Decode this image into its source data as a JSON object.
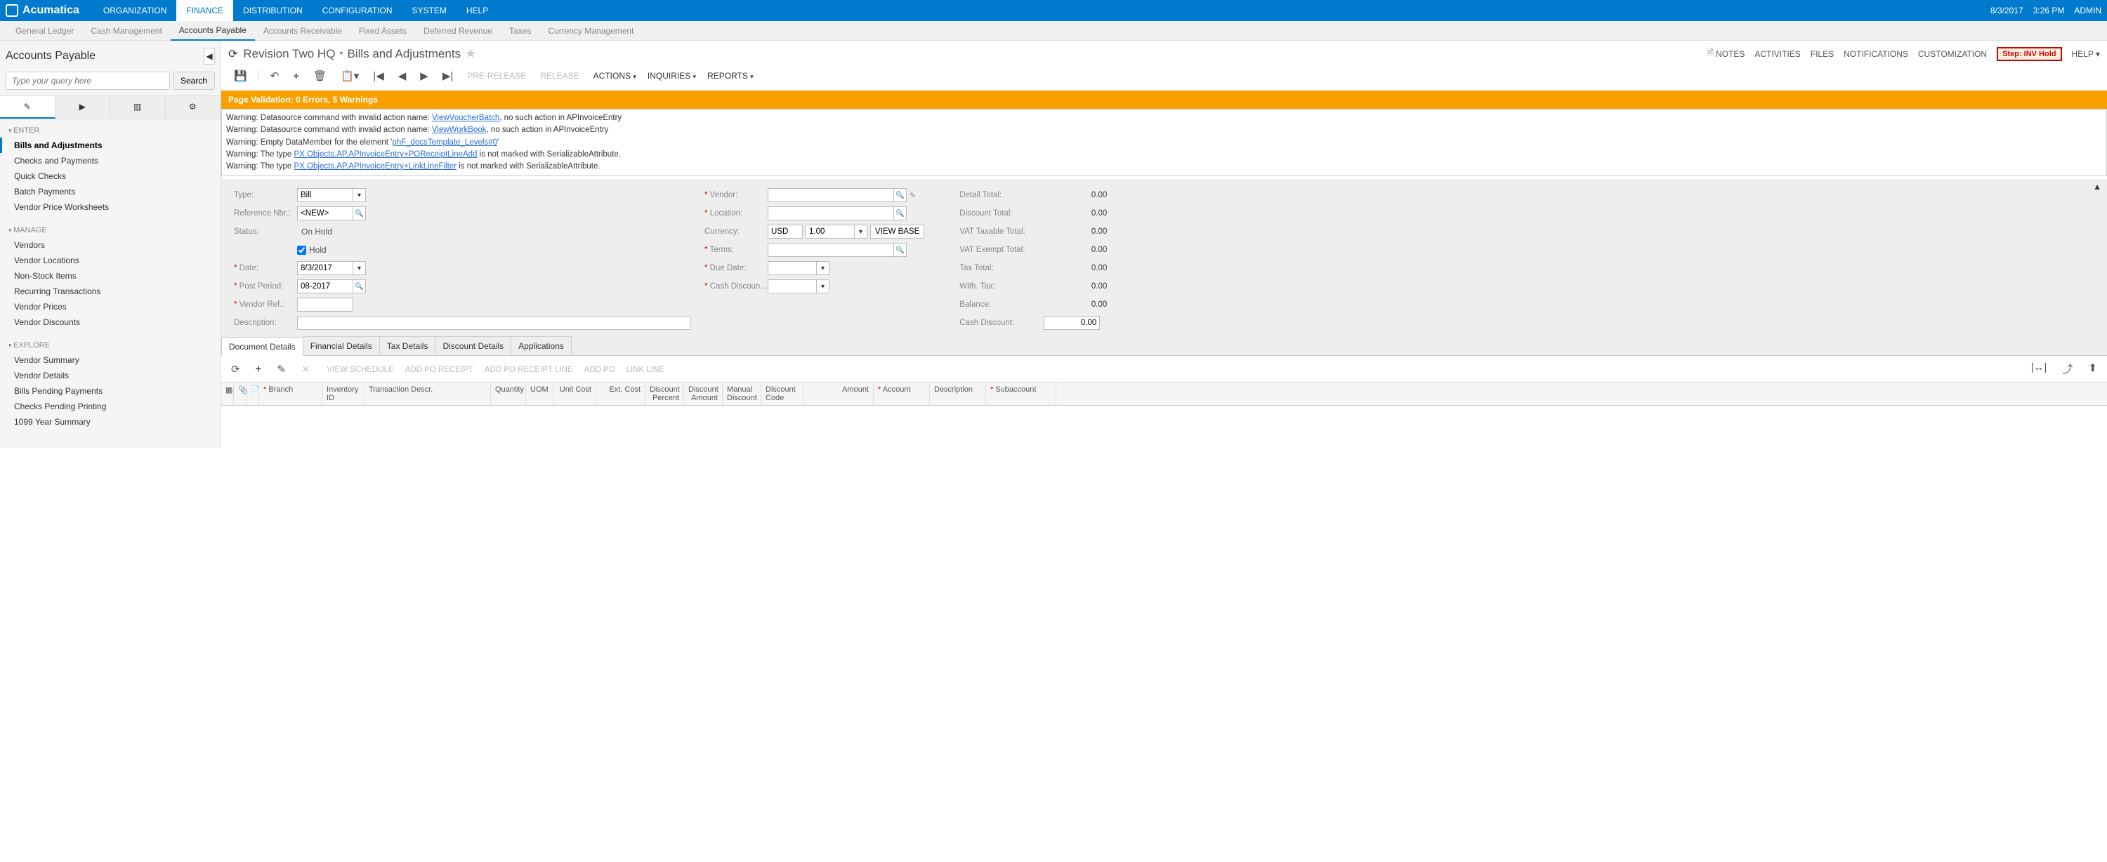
{
  "topbar": {
    "brand": "Acumatica",
    "items": [
      "ORGANIZATION",
      "FINANCE",
      "DISTRIBUTION",
      "CONFIGURATION",
      "SYSTEM",
      "HELP"
    ],
    "active": "FINANCE",
    "date": "8/3/2017",
    "time": "3:26 PM",
    "user": "ADMIN"
  },
  "subnav": {
    "items": [
      "General Ledger",
      "Cash Management",
      "Accounts Payable",
      "Accounts Receivable",
      "Fixed Assets",
      "Deferred Revenue",
      "Taxes",
      "Currency Management"
    ],
    "active": "Accounts Payable"
  },
  "sidebar": {
    "title": "Accounts Payable",
    "search_placeholder": "Type your query here",
    "search_btn": "Search",
    "groups": [
      {
        "name": "ENTER",
        "items": [
          "Bills and Adjustments",
          "Checks and Payments",
          "Quick Checks",
          "Batch Payments",
          "Vendor Price Worksheets"
        ],
        "active": "Bills and Adjustments"
      },
      {
        "name": "MANAGE",
        "items": [
          "Vendors",
          "Vendor Locations",
          "Non-Stock Items",
          "Recurring Transactions",
          "Vendor Prices",
          "Vendor Discounts"
        ]
      },
      {
        "name": "EXPLORE",
        "items": [
          "Vendor Summary",
          "Vendor Details",
          "Bills Pending Payments",
          "Checks Pending Printing",
          "1099 Year Summary"
        ]
      }
    ]
  },
  "page": {
    "breadcrumb_company": "Revision Two HQ",
    "breadcrumb_title": "Bills and Adjustments",
    "header_links": [
      "NOTES",
      "ACTIVITIES",
      "FILES",
      "NOTIFICATIONS",
      "CUSTOMIZATION"
    ],
    "step": "Step: INV Hold",
    "help": "HELP",
    "toolbar_text_disabled": [
      "PRE-RELEASE",
      "RELEASE"
    ],
    "toolbar_menus": [
      "ACTIONS",
      "INQUIRIES",
      "REPORTS"
    ]
  },
  "validation": {
    "summary": "Page Validation: 0 Errors, 5 Warnings",
    "warnings": [
      {
        "prefix": "Warning: Datasource command with invalid action name: ",
        "link": "ViewVoucherBatch",
        "suffix": ", no such action in APInvoiceEntry"
      },
      {
        "prefix": "Warning: Datasource command with invalid action name: ",
        "link": "ViewWorkBook",
        "suffix": ", no such action in APInvoiceEntry"
      },
      {
        "prefix": "Warning: Empty DataMember for the element '",
        "link": "phF_docsTemplate_Levels#0",
        "suffix": "'"
      },
      {
        "prefix": "Warning: The type ",
        "link": "PX.Objects.AP.APInvoiceEntry+POReceiptLineAdd",
        "suffix": " is not marked with SerializableAttribute."
      },
      {
        "prefix": "Warning: The type ",
        "link": "PX.Objects.AP.APInvoiceEntry+LinkLineFilter",
        "suffix": " is not marked with SerializableAttribute."
      }
    ]
  },
  "form": {
    "labels": {
      "type": "Type:",
      "ref": "Reference Nbr.:",
      "status": "Status:",
      "hold": "Hold",
      "date": "Date:",
      "post": "Post Period:",
      "vendor_ref": "Vendor Ref.:",
      "desc": "Description:",
      "vendor": "Vendor:",
      "location": "Location:",
      "currency": "Currency:",
      "viewbase": "VIEW BASE",
      "terms": "Terms:",
      "due": "Due Date:",
      "cash_disc": "Cash Discoun..."
    },
    "values": {
      "type": "Bill",
      "ref": "<NEW>",
      "status": "On Hold",
      "hold": true,
      "date": "8/3/2017",
      "post": "08-2017",
      "vendor_ref": "",
      "desc": "",
      "vendor": "",
      "location": "",
      "currency": "USD",
      "rate": "1.00",
      "terms": "",
      "due": "",
      "cash_disc": ""
    },
    "totals": {
      "detail": "Detail Total:",
      "detail_v": "0.00",
      "discount": "Discount Total:",
      "discount_v": "0.00",
      "vat_tax": "VAT Taxable Total:",
      "vat_tax_v": "0.00",
      "vat_ex": "VAT Exempt Total:",
      "vat_ex_v": "0.00",
      "tax": "Tax Total:",
      "tax_v": "0.00",
      "with": "With. Tax:",
      "with_v": "0.00",
      "balance": "Balance:",
      "balance_v": "0.00",
      "cashd": "Cash Discount:",
      "cashd_v": "0.00"
    }
  },
  "doc_tabs": [
    "Document Details",
    "Financial Details",
    "Tax Details",
    "Discount Details",
    "Applications"
  ],
  "grid_toolbar": [
    "VIEW SCHEDULE",
    "ADD PO RECEIPT",
    "ADD PO RECEIPT LINE",
    "ADD PO",
    "LINK LINE"
  ],
  "grid_cols": [
    {
      "label": "Branch",
      "req": true,
      "w": 90
    },
    {
      "label": "Inventory ID",
      "w": 60
    },
    {
      "label": "Transaction Descr.",
      "w": 180
    },
    {
      "label": "Quantity",
      "w": 50,
      "align": "right"
    },
    {
      "label": "UOM",
      "w": 40
    },
    {
      "label": "Unit Cost",
      "w": 60,
      "align": "right"
    },
    {
      "label": "Ext. Cost",
      "w": 70,
      "align": "right"
    },
    {
      "label": "Discount Percent",
      "w": 55,
      "align": "right"
    },
    {
      "label": "Discount Amount",
      "w": 55,
      "align": "right"
    },
    {
      "label": "Manual Discount",
      "w": 55
    },
    {
      "label": "Discount Code",
      "w": 60
    },
    {
      "label": "Amount",
      "w": 100,
      "align": "right"
    },
    {
      "label": "Account",
      "req": true,
      "w": 80
    },
    {
      "label": "Description",
      "w": 80
    },
    {
      "label": "Subaccount",
      "req": true,
      "w": 100
    }
  ]
}
